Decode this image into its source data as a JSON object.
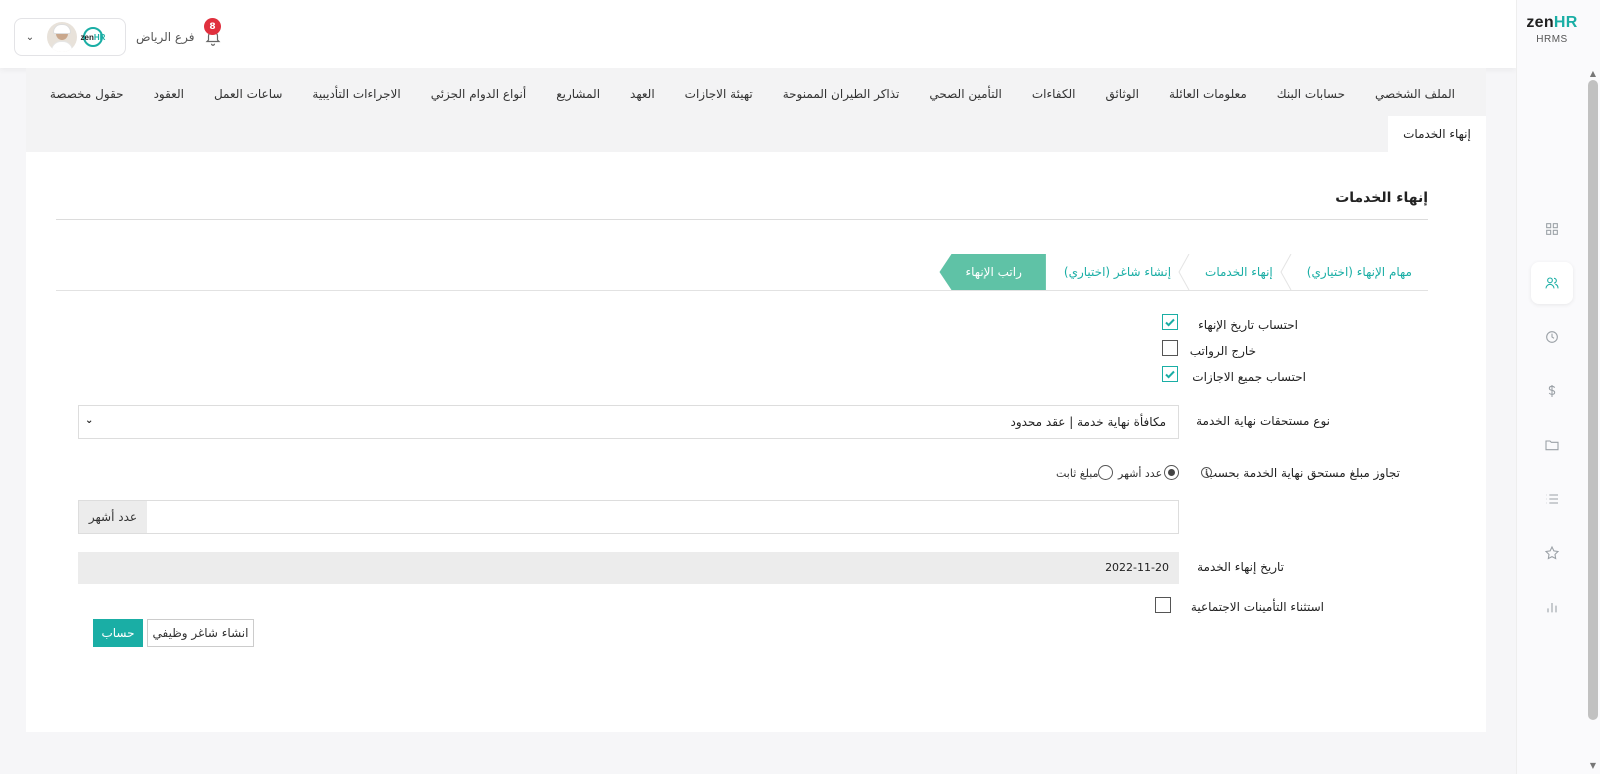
{
  "brand": {
    "logo_zen": "zen",
    "logo_hr": "HR",
    "subtitle": "HRMS"
  },
  "header": {
    "branch": "فرع الرياض",
    "notification_count": "8",
    "mini_logo_zen": "zen",
    "mini_logo_hr": "HR"
  },
  "sidebar": {
    "icons": [
      "dashboard-icon",
      "people-icon",
      "clock-icon",
      "dollar-icon",
      "folder-icon",
      "list-icon",
      "star-icon",
      "chart-icon"
    ],
    "active": "people-icon"
  },
  "tabs": {
    "row1": [
      "الملف الشخصي",
      "حسابات البنك",
      "معلومات العائلة",
      "الوثائق",
      "الكفاءات",
      "التأمين الصحي",
      "تذاكر الطيران الممنوحة",
      "تهيئة الاجازات",
      "العهد",
      "المشاريع",
      "أنواع الدوام الجزئي",
      "الاجراءات التأديبية",
      "ساعات العمل",
      "العقود",
      "حقول مخصصة"
    ],
    "active": "إنهاء الخدمات"
  },
  "page": {
    "title": "إنهاء الخدمات",
    "wizard": [
      "مهام الإنهاء (اختياري)",
      "إنهاء الخدمات",
      "إنشاء شاغر (اختياري)",
      "راتب الإنهاء"
    ],
    "wizard_active_index": 3
  },
  "form": {
    "calc_termination_date": {
      "label": "احتساب تاريخ الإنهاء",
      "checked": true
    },
    "outside_payroll": {
      "label": "خارج الرواتب",
      "checked": false
    },
    "calc_all_leaves": {
      "label": "احتساب جميع الاجازات",
      "checked": true
    },
    "eos_type": {
      "label": "نوع مستحقات نهاية الخدمة",
      "value": "مكافأة نهاية خدمة | عقد محدود"
    },
    "override": {
      "label": "تجاوز مبلغ مستحق نهاية الخدمة بحسب",
      "options": [
        "عدد أشهر",
        "مبلغ ثابت"
      ],
      "selected": "عدد أشهر"
    },
    "months_input": {
      "value": "",
      "addon": "عدد أشهر"
    },
    "end_date": {
      "label": "تاريخ إنهاء الخدمة",
      "value": "2022-11-20"
    },
    "exclude_gosi": {
      "label": "استثناء التأمينات الاجتماعية",
      "checked": false
    }
  },
  "buttons": {
    "calculate": "حساب",
    "create_vacancy": "انشاء شاغر وظيفي"
  },
  "colors": {
    "accent": "#1aaea5",
    "wizard_active": "#5fc2a6",
    "badge": "#e0303e"
  }
}
